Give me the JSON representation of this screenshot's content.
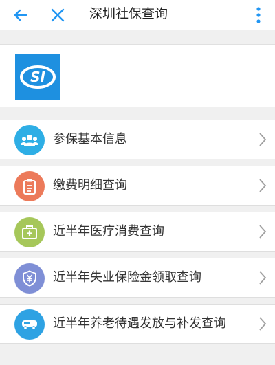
{
  "header": {
    "title": "深圳社保查询"
  },
  "logo": {
    "text": "SI",
    "color": "#1e90e0"
  },
  "menu": [
    {
      "label": "参保基本信息",
      "icon": "people-icon",
      "color": "#2eaee5"
    },
    {
      "label": "缴费明细查询",
      "icon": "clipboard-icon",
      "color": "#ec7a5a"
    },
    {
      "label": "近半年医疗消费查询",
      "icon": "medical-kit-icon",
      "color": "#a6c75a"
    },
    {
      "label": "近半年失业保险金领取查询",
      "icon": "yuan-shield-icon",
      "color": "#7f8fd6"
    },
    {
      "label": "近半年养老待遇发放与补发查询",
      "icon": "bus-card-icon",
      "color": "#2ea2e3"
    }
  ],
  "colors": {
    "accent": "#2196f3"
  }
}
